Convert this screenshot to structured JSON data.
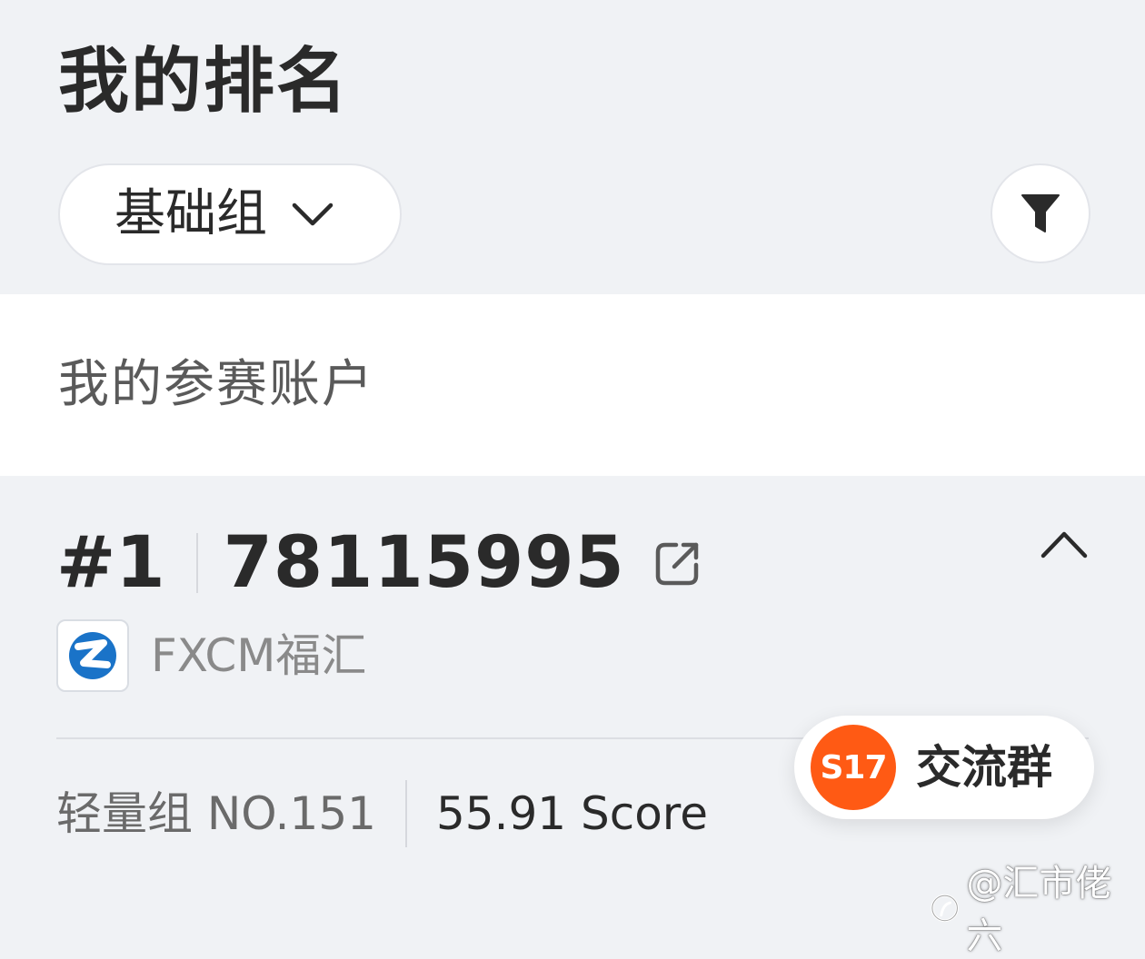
{
  "header": {
    "title": "我的排名"
  },
  "filters": {
    "group_label": "基础组",
    "group_icon": "chevron-down-icon",
    "filter_icon": "funnel-icon"
  },
  "section": {
    "title": "我的参赛账户"
  },
  "account_card": {
    "rank": "#1",
    "account_id": "78115995",
    "link_icon": "external-link-icon",
    "collapse_icon": "chevron-up-icon",
    "broker_name": "FXCM福汇",
    "broker_logo_color": "#1a73c8",
    "group_rank": "轻量组 NO.151",
    "score": "55.91 Score"
  },
  "fab": {
    "badge": "S17",
    "label": "交流群",
    "badge_color": "#ff5a14"
  },
  "watermark": {
    "text": "@汇市佬六"
  }
}
